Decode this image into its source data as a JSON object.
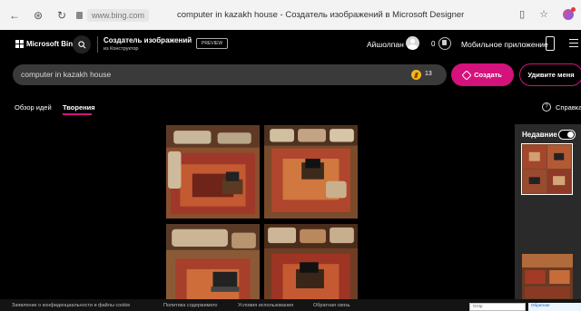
{
  "browser": {
    "tab_title": "computer in kazakh house - Создатель изображений в Microsoft Designer",
    "url": "www.bing.com"
  },
  "header": {
    "brand": "Microsoft Bing",
    "designer_title": "Создатель изображений",
    "designer_subtitle": "из Конструктор",
    "preview_badge": "PREVIEW",
    "username": "Айшолпан",
    "rewards_count": "0",
    "mobile_app": "Мобильное приложение"
  },
  "prompt": {
    "value": "computer in kazakh house",
    "boost_count": "13",
    "create_label": "Создать",
    "surprise_label": "Удивите меня"
  },
  "tabs": {
    "explore": "Обзор идей",
    "creations": "Творения",
    "help": "Справка"
  },
  "recent": {
    "title": "Недавние"
  },
  "footer": {
    "privacy": "Заявление о конфиденциальности и файлы cookie",
    "content_policy": "Политика содержимого",
    "terms": "Условия использования",
    "feedback_link": "Обратная связь",
    "feedback_box": "Отпр",
    "feedback_button": "Обратная"
  },
  "colors": {
    "accent": "#d3127c",
    "background": "#000000",
    "prompt_bg": "#3a3a3a",
    "boost": "#f5b61b"
  },
  "icons": [
    "back-icon",
    "tracking-icon",
    "refresh-icon",
    "lock-icon",
    "search-icon",
    "avatar",
    "rewards-icon",
    "phone-icon",
    "menu-icon",
    "boost-icon",
    "wand-icon",
    "help-icon"
  ]
}
